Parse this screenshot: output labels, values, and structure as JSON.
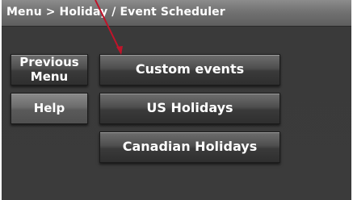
{
  "header": {
    "title": "Menu > Holiday / Event Scheduler"
  },
  "left_buttons": {
    "previous_menu_line1": "Previous",
    "previous_menu_line2": "Menu",
    "help": "Help"
  },
  "menu": {
    "custom_events": "Custom events",
    "us_holidays": "US Holidays",
    "canadian_holidays": "Canadian Holidays"
  },
  "colors": {
    "screen_bg": "#3b3b3b",
    "title_bar": "#727272",
    "text": "#ffffff",
    "callout_arrow": "#c0142a"
  }
}
